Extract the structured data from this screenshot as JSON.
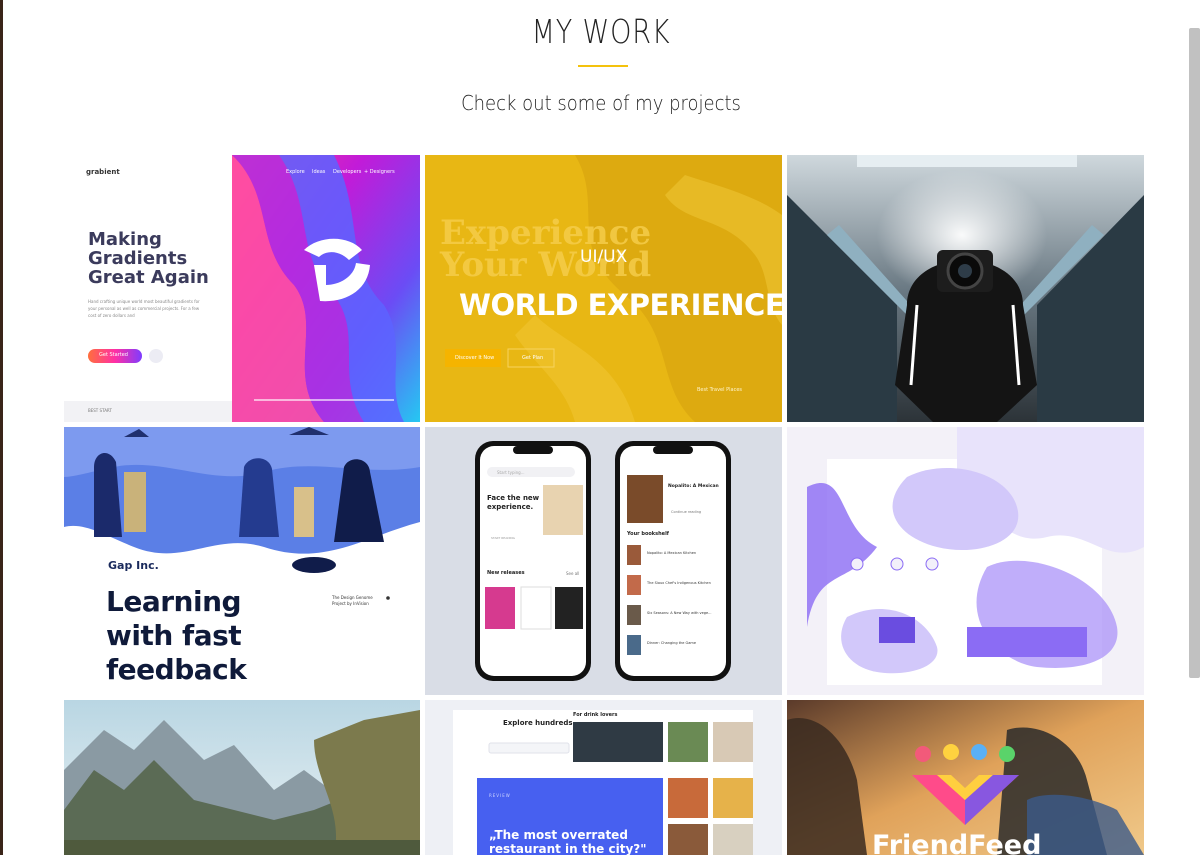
{
  "section": {
    "title": "MY WORK",
    "subtitle": "Check out some of my projects"
  },
  "projects": [
    {
      "logo": "grabient",
      "nav": [
        "Explore",
        "Ideas",
        "Developers",
        "+ Designers"
      ],
      "heading": [
        "Making",
        "Gradients",
        "Great Again"
      ],
      "body": "Hand crafting unique world most beautiful gradients for your personal as well as commercial projects. For a few cost of zero dollars and",
      "cta": "Get Started",
      "footer": "BEST START"
    },
    {
      "script_text": [
        "Experience",
        "Your World"
      ],
      "tag": "UI/UX",
      "headline": "WORLD EXPERIENCE",
      "button_primary": "Discover It Now",
      "button_secondary": "Get Plan",
      "footer": "Best Travel Places"
    },
    {
      "alt": "photographer-smoke-escalator"
    },
    {
      "brand": "Gap Inc.",
      "headline": [
        "Learning",
        "with fast",
        "feedback"
      ],
      "note": "The Design Genome Project by InVision"
    },
    {
      "phone1": {
        "time": "9:41",
        "search": "Start typing...",
        "heading": [
          "Face the new",
          "experience."
        ],
        "desc": "In the history of modern literature, there is probably one greater than.",
        "button": "START READING",
        "section": "New releases",
        "see_all": "See all",
        "books": [
          "Boring Girls: A Novel",
          "Pink Me Paint That We Fall"
        ]
      },
      "phone2": {
        "time": "9:41",
        "currently_reading": "CURRENTLY READING",
        "book_title": [
          "Nopalito: A Mexican",
          "Kitchen"
        ],
        "continue": "Continue reading",
        "section": "Your bookshelf",
        "shelf_count": "12 Books",
        "shelf": [
          "Nopalito: A Mexican Kitchen",
          "The Sioux Chef's Indigenous Kitchen",
          "Six Seasons: A New Way with vege...",
          "Dinner: Changing the Game"
        ]
      }
    },
    {
      "alt": "purple-isometric-landing-page"
    },
    {
      "alt": "mountain-valley-landscape"
    },
    {
      "heading": "Explore hundreds",
      "section": "For drink lovers",
      "card_label": "REVIEW",
      "quote": "„The most overrated restaurant in the city?\""
    },
    {
      "brand": "FriendFeed"
    }
  ]
}
